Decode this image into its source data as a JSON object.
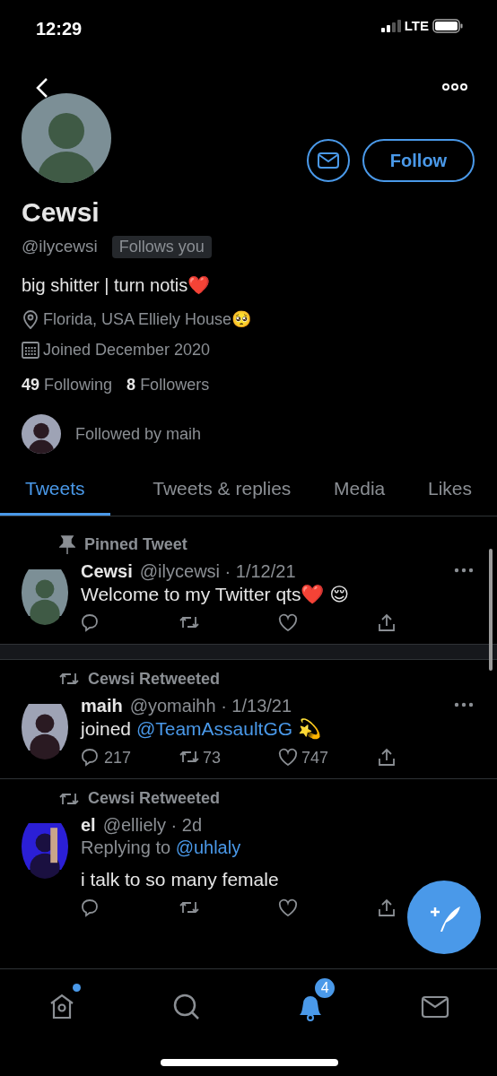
{
  "status_bar": {
    "time": "12:29",
    "network": "LTE"
  },
  "profile": {
    "name": "Cewsi",
    "handle": "@ilycewsi",
    "follows_you": "Follows you",
    "bio": "big shitter | turn notis❤️",
    "location": "Florida, USA Elliely House🥺",
    "joined": "Joined December 2020",
    "following_count": "49",
    "following_label": "Following",
    "followers_count": "8",
    "followers_label": "Followers",
    "followed_by": "Followed by maih",
    "follow_button": "Follow"
  },
  "tabs": [
    {
      "label": "Tweets",
      "selected": true
    },
    {
      "label": "Tweets & replies",
      "selected": false
    },
    {
      "label": "Media",
      "selected": false
    },
    {
      "label": "Likes",
      "selected": false
    }
  ],
  "tweets": [
    {
      "kind": "pinned",
      "context": "Pinned Tweet",
      "name": "Cewsi",
      "handle": "@ilycewsi",
      "time": "· 1/12/21",
      "text": "Welcome to my Twitter qts❤️ 😌"
    },
    {
      "kind": "retweet",
      "context": "Cewsi Retweeted",
      "name": "maih",
      "handle": "@yomaihh",
      "time": "· 1/13/21",
      "text_before": "joined ",
      "mention": "@TeamAssaultGG",
      "text_after": " 💫",
      "replies": "217",
      "retweets": "73",
      "likes": "747"
    },
    {
      "kind": "retweet",
      "context": "Cewsi Retweeted",
      "name": "el",
      "handle": "@elliely",
      "time": "· 2d",
      "reply_prefix": "Replying to ",
      "reply_to": "@uhlaly",
      "text": "i talk to so many female"
    }
  ],
  "nav": [
    {
      "kind": "home",
      "selected": false,
      "dot": true
    },
    {
      "kind": "search",
      "selected": false
    },
    {
      "kind": "bell",
      "selected": true,
      "badge": "4"
    },
    {
      "kind": "mail",
      "selected": false
    }
  ]
}
